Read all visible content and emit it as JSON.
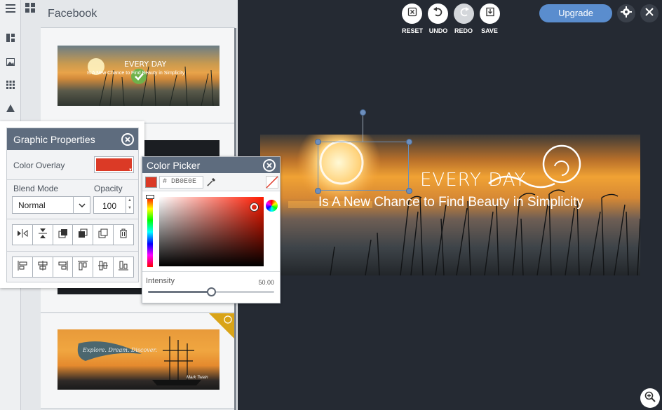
{
  "panel": {
    "title": "Facebook",
    "cards": [
      {
        "line1": "EVERY DAY",
        "line2": "Is A New Chance to Find Beauty in Simplicity"
      },
      {
        "line1": "Explore. Dream. Discover.",
        "signature": "Mark Twain"
      }
    ]
  },
  "toolbar": {
    "reset_label": "RESET",
    "undo_label": "UNDO",
    "redo_label": "REDO",
    "save_label": "SAVE",
    "upgrade_label": "Upgrade"
  },
  "banner": {
    "line1": "EVERY DAY",
    "line2": "Is A New Chance to Find Beauty in Simplicity"
  },
  "graphic_properties": {
    "title": "Graphic Properties",
    "color_overlay_label": "Color Overlay",
    "overlay_color": "#DB3A26",
    "blend_mode_label": "Blend Mode",
    "blend_mode_value": "Normal",
    "opacity_label": "Opacity",
    "opacity_value": "100"
  },
  "color_picker": {
    "title": "Color Picker",
    "hex_value": "# DB0E0E",
    "intensity_label": "Intensity",
    "intensity_value": "50.00",
    "intensity_fraction": 0.5
  },
  "icons": {
    "arrange": [
      "flip-horizontal-icon",
      "flip-vertical-icon",
      "bring-forward-icon",
      "send-backward-icon",
      "duplicate-icon",
      "trash-icon"
    ],
    "align": [
      "align-left-icon",
      "align-center-h-icon",
      "align-right-icon",
      "align-top-icon",
      "align-middle-icon",
      "align-bottom-icon"
    ]
  },
  "colors": {
    "accent": "#5A8DCE",
    "canvas_bg": "#252A33",
    "header": "#5E6C7E"
  }
}
